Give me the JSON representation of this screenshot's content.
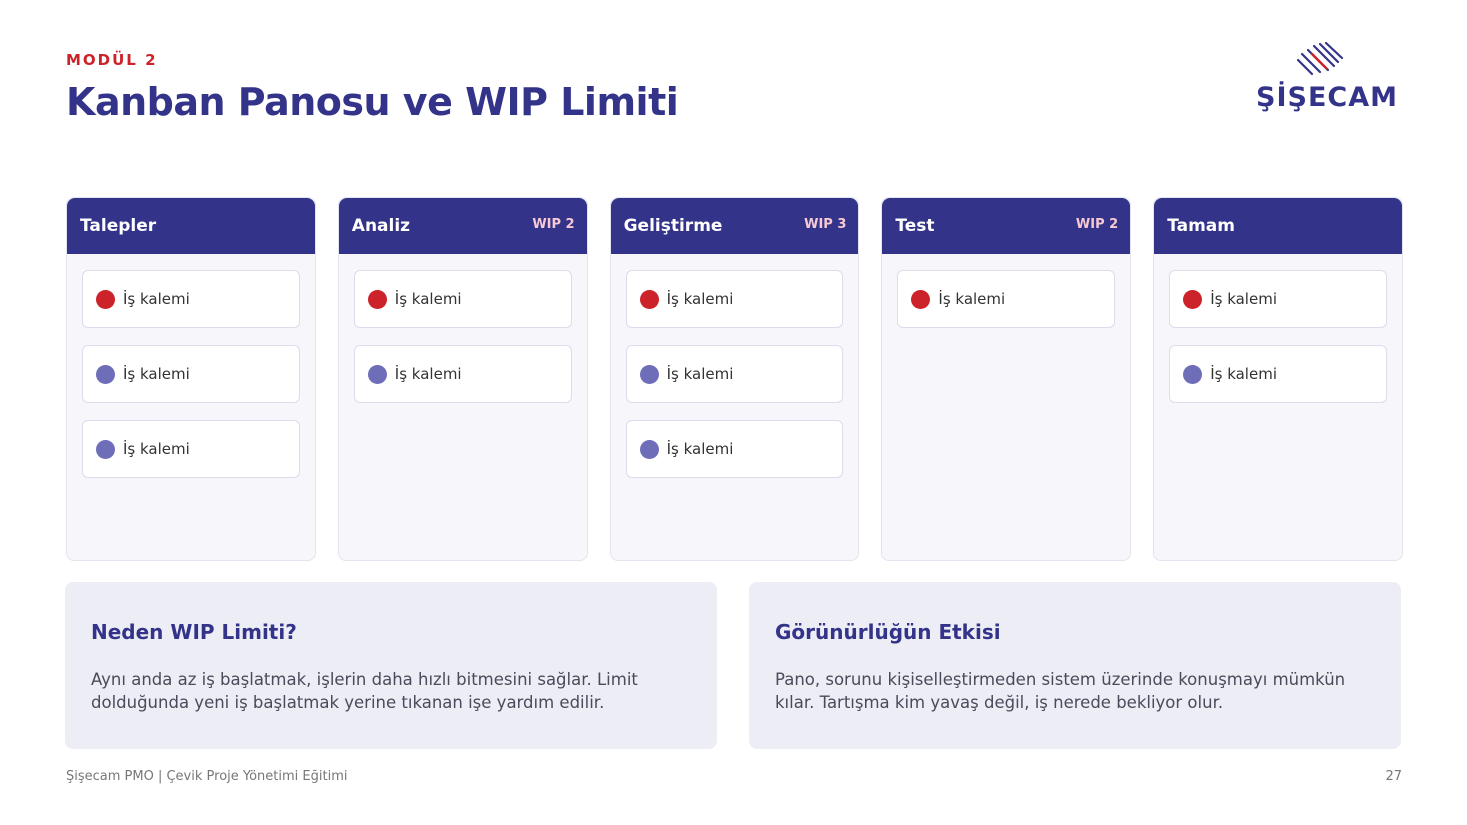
{
  "header": {
    "module": "MODÜL 2",
    "title": "Kanban Panosu ve WIP Limiti"
  },
  "logo": {
    "text": "ŞİŞECAM",
    "icon": "sisecam-lines-icon"
  },
  "colors": {
    "primary": "#33338a",
    "accent": "#cc2229",
    "dot_secondary": "#6e6eb8"
  },
  "board": {
    "columns": [
      {
        "name": "Talepler",
        "wip": "",
        "cards": [
          {
            "label": "İş kalemi",
            "dot": "red"
          },
          {
            "label": "İş kalemi",
            "dot": "blue"
          },
          {
            "label": "İş kalemi",
            "dot": "blue"
          }
        ]
      },
      {
        "name": "Analiz",
        "wip": "WIP 2",
        "cards": [
          {
            "label": "İş kalemi",
            "dot": "red"
          },
          {
            "label": "İş kalemi",
            "dot": "blue"
          }
        ]
      },
      {
        "name": "Geliştirme",
        "wip": "WIP 3",
        "cards": [
          {
            "label": "İş kalemi",
            "dot": "red"
          },
          {
            "label": "İş kalemi",
            "dot": "blue"
          },
          {
            "label": "İş kalemi",
            "dot": "blue"
          }
        ]
      },
      {
        "name": "Test",
        "wip": "WIP 2",
        "cards": [
          {
            "label": "İş kalemi",
            "dot": "red"
          }
        ]
      },
      {
        "name": "Tamam",
        "wip": "",
        "cards": [
          {
            "label": "İş kalemi",
            "dot": "red"
          },
          {
            "label": "İş kalemi",
            "dot": "blue"
          }
        ]
      }
    ]
  },
  "panels": [
    {
      "title": "Neden WIP Limiti?",
      "text": "Aynı anda az iş başlatmak, işlerin daha hızlı bitmesini sağlar. Limit dolduğunda yeni iş başlatmak yerine tıkanan işe yardım edilir."
    },
    {
      "title": "Görünürlüğün Etkisi",
      "text": "Pano, sorunu kişiselleştirmeden sistem üzerinde konuşmayı mümkün kılar. Tartışma kim yavaş değil, iş nerede bekliyor olur."
    }
  ],
  "footer": {
    "text": "Şişecam PMO | Çevik Proje Yönetimi Eğitimi",
    "page": "27"
  }
}
